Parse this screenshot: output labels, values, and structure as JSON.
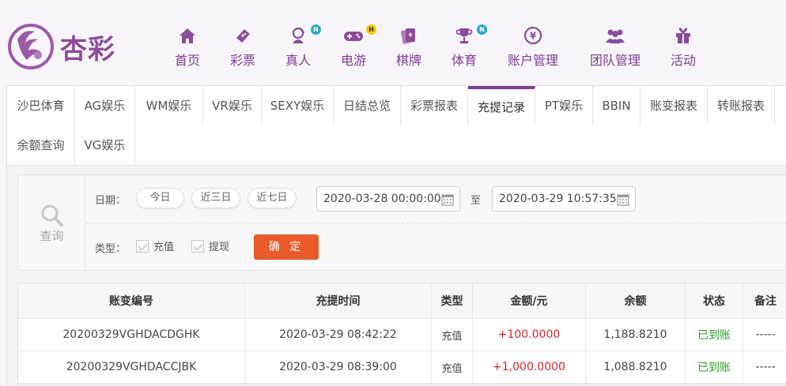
{
  "brand": {
    "name": "杏彩"
  },
  "nav": [
    {
      "label": "首页",
      "icon": "home-icon"
    },
    {
      "label": "彩票",
      "icon": "lottery-ticket-icon"
    },
    {
      "label": "真人",
      "icon": "live-dealer-icon",
      "badge": "N"
    },
    {
      "label": "电游",
      "icon": "gamepad-icon",
      "badge": "H"
    },
    {
      "label": "棋牌",
      "icon": "cards-icon"
    },
    {
      "label": "体育",
      "icon": "trophy-icon",
      "badge": "N"
    },
    {
      "label": "账户管理",
      "icon": "account-coin-icon"
    },
    {
      "label": "团队管理",
      "icon": "team-icon"
    },
    {
      "label": "活动",
      "icon": "gift-icon"
    }
  ],
  "tabs": [
    {
      "label": "沙巴体育"
    },
    {
      "label": "AG娱乐"
    },
    {
      "label": "WM娱乐"
    },
    {
      "label": "VR娱乐"
    },
    {
      "label": "SEXY娱乐"
    },
    {
      "label": "日结总览"
    },
    {
      "label": "彩票报表"
    },
    {
      "label": "充提记录",
      "active": true
    },
    {
      "label": "PT娱乐"
    },
    {
      "label": "BBIN"
    },
    {
      "label": "账变报表"
    },
    {
      "label": "转账报表"
    },
    {
      "label": "余额查询"
    },
    {
      "label": "VG娱乐"
    }
  ],
  "filter": {
    "search_label": "查询",
    "date_label": "日期：",
    "quick_dates": [
      "今日",
      "近三日",
      "近七日"
    ],
    "start_date": "2020-03-28 00:00:00",
    "range_sep": "至",
    "end_date": "2020-03-29 10:57:35",
    "type_label": "类型：",
    "types": [
      "充值",
      "提现"
    ],
    "confirm_label": "确 定"
  },
  "table": {
    "columns": [
      "账变编号",
      "充提时间",
      "类型",
      "金额/元",
      "余额",
      "状态",
      "备注"
    ],
    "rows": [
      [
        "20200329VGHDACDGHK",
        "2020-03-29 08:42:22",
        "充值",
        "+100.0000",
        "1,188.8210",
        "已到账",
        "-----"
      ],
      [
        "20200329VGHDACCJBK",
        "2020-03-29 08:39:00",
        "充值",
        "+1,000.0000",
        "1,088.8210",
        "已到账",
        "-----"
      ]
    ]
  },
  "colors": {
    "brand_purple": "#7f3d96",
    "confirm_orange": "#e85c2b",
    "amount_red": "#d8262c",
    "status_green": "#2a9c2a"
  }
}
